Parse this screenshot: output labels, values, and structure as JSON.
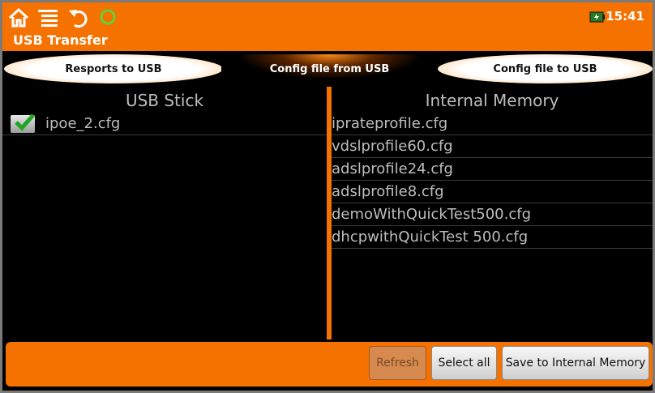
{
  "status_bar": {
    "clock": "15:41",
    "icons": [
      "home-icon",
      "menu-list-icon",
      "undo-icon",
      "ring-indicator-icon",
      "battery-icon"
    ]
  },
  "app": {
    "title": "USB Transfer"
  },
  "tabs": [
    {
      "label": "Resports to USB",
      "active": false
    },
    {
      "label": "Config file from USB",
      "active": true
    },
    {
      "label": "Config file to USB",
      "active": false
    }
  ],
  "usb_stick": {
    "header": "USB Stick",
    "files": [
      {
        "name": "ipoe_2.cfg",
        "checked": true
      }
    ]
  },
  "internal_memory": {
    "header": "Internal Memory",
    "files": [
      "iprateprofile.cfg",
      "vdslprofile60.cfg",
      "adslprofile24.cfg",
      "adslprofile8.cfg",
      "demoWithQuickTest500.cfg",
      "dhcpwithQuickTest 500.cfg"
    ]
  },
  "actions": {
    "refresh": "Refresh",
    "select_all": "Select all",
    "save_internal": "Save to Internal Memory"
  },
  "colors": {
    "accent": "#f57200",
    "background": "#000000",
    "text": "#bdbdbd"
  }
}
